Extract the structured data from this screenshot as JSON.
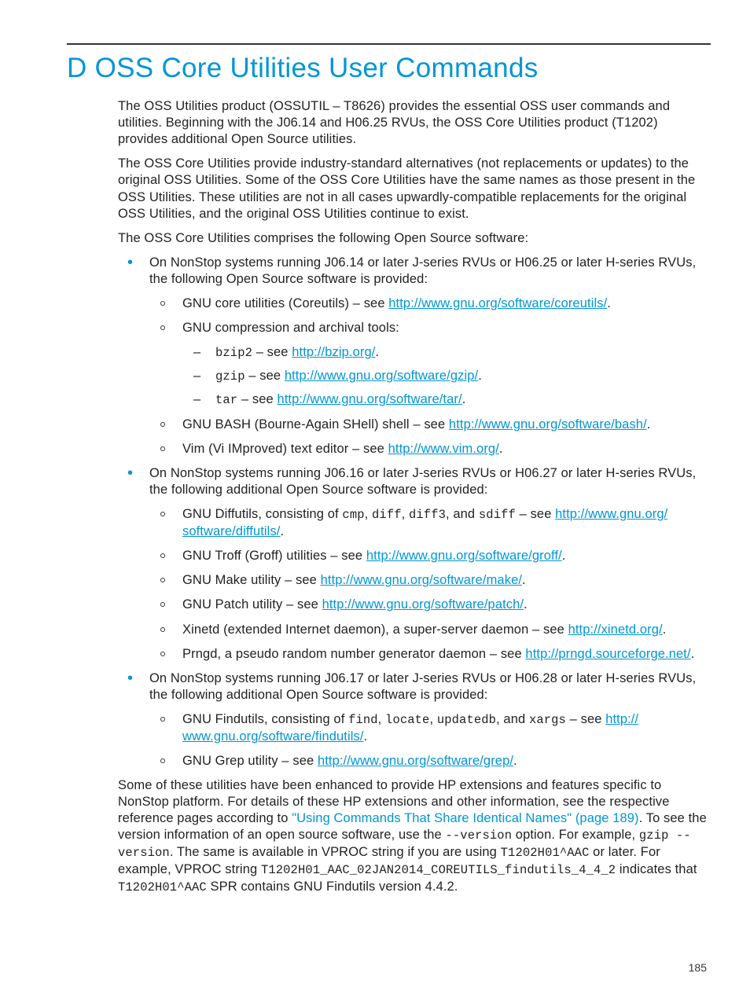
{
  "title": "D OSS Core Utilities User Commands",
  "intro1": "The OSS Utilities product (OSSUTIL – T8626) provides the essential OSS user commands and utilities. Beginning with the J06.14 and H06.25 RVUs, the OSS Core Utilities product (T1202) provides additional Open Source utilities.",
  "intro2": "The OSS Core Utilities provide industry-standard alternatives (not replacements or updates) to the original OSS Utilities. Some of the OSS Core Utilities have the same names as those present in the OSS Utilities. These utilities are not in all cases upwardly-compatible replacements for the original OSS Utilities, and the original OSS Utilities continue to exist.",
  "intro3": "The OSS Core Utilities comprises the following Open Source software:",
  "b1_lead": "On NonStop systems running J06.14 or later J-series RVUs or H06.25 or later H-series RVUs, the following Open Source software is provided:",
  "b1s1_pre": "GNU core utilities (Coreutils) – see ",
  "b1s1_link": "http://www.gnu.org/software/coreutils/",
  "b1s2": "GNU compression and archival tools:",
  "b1s2a_code": "bzip2",
  "b1s2a_mid": " – see ",
  "b1s2a_link": "http://bzip.org/",
  "b1s2b_code": "gzip",
  "b1s2b_mid": " – see ",
  "b1s2b_link": "http://www.gnu.org/software/gzip/",
  "b1s2c_code": "tar",
  "b1s2c_mid": " – see ",
  "b1s2c_link": "http://www.gnu.org/software/tar/",
  "b1s3_pre": "GNU BASH (Bourne-Again SHell) shell – see ",
  "b1s3_link": "http://www.gnu.org/software/bash/",
  "b1s4_pre": "Vim (Vi IMproved) text editor – see ",
  "b1s4_link": "http://www.vim.org/",
  "b2_lead": "On NonStop systems running J06.16 or later J-series RVUs or H06.27 or later H-series RVUs, the following additional Open Source software is provided:",
  "b2s1_pre": "GNU Diffutils, consisting of ",
  "b2s1_c1": "cmp",
  "b2s1_sep1": ", ",
  "b2s1_c2": "diff",
  "b2s1_sep2": ", ",
  "b2s1_c3": "diff3",
  "b2s1_sep3": ", and ",
  "b2s1_c4": "sdiff",
  "b2s1_mid": " – see ",
  "b2s1_link": "http://www.gnu.org/ software/diffutils/",
  "b2s2_pre": "GNU Troff (Groff) utilities – see ",
  "b2s2_link": "http://www.gnu.org/software/groff/",
  "b2s3_pre": "GNU Make utility – see ",
  "b2s3_link": "http://www.gnu.org/software/make/",
  "b2s4_pre": "GNU Patch utility – see ",
  "b2s4_link": "http://www.gnu.org/software/patch/",
  "b2s5_pre": "Xinetd (extended Internet daemon), a super-server daemon – see ",
  "b2s5_link": "http://xinetd.org/",
  "b2s6_pre": "Prngd, a pseudo random number generator daemon – see ",
  "b2s6_link": "http://prngd.sourceforge.net/",
  "b3_lead": "On NonStop systems running J06.17 or later J-series RVUs or H06.28 or later H-series RVUs, the following additional Open Source software is provided:",
  "b3s1_pre": "GNU Findutils, consisting of ",
  "b3s1_c1": "find",
  "b3s1_sep1": ", ",
  "b3s1_c2": "locate",
  "b3s1_sep2": ", ",
  "b3s1_c3": "updatedb",
  "b3s1_sep3": ", and ",
  "b3s1_c4": "xargs",
  "b3s1_mid": " – see ",
  "b3s1_link": "http:// www.gnu.org/software/findutils/",
  "b3s2_pre": "GNU Grep utility – see ",
  "b3s2_link": "http://www.gnu.org/software/grep/",
  "closing_p1": "Some of these utilities have been enhanced to provide HP extensions and features specific to NonStop platform. For details of these HP extensions and other information, see the respective reference pages according to ",
  "closing_xref": "\"Using Commands That Share Identical Names\" (page 189)",
  "closing_p2a": ". To see the version information of an open source software, use the ",
  "closing_c1": "--version",
  "closing_p2b": " option. For example, ",
  "closing_c2": "gzip --version",
  "closing_p2c": ". The same is available in VPROC string if you are using ",
  "closing_c3": "T1202H01^AAC",
  "closing_p2d": " or later. For example, VPROC string ",
  "closing_c4": "T1202H01_AAC_02JAN2014_COREUTILS_findutils_4_4_2",
  "closing_p2e": " indicates that ",
  "closing_c5": "T1202H01^AAC",
  "closing_p2f": " SPR contains GNU Findutils version 4.4.2.",
  "period": ".",
  "pagenum": "185"
}
